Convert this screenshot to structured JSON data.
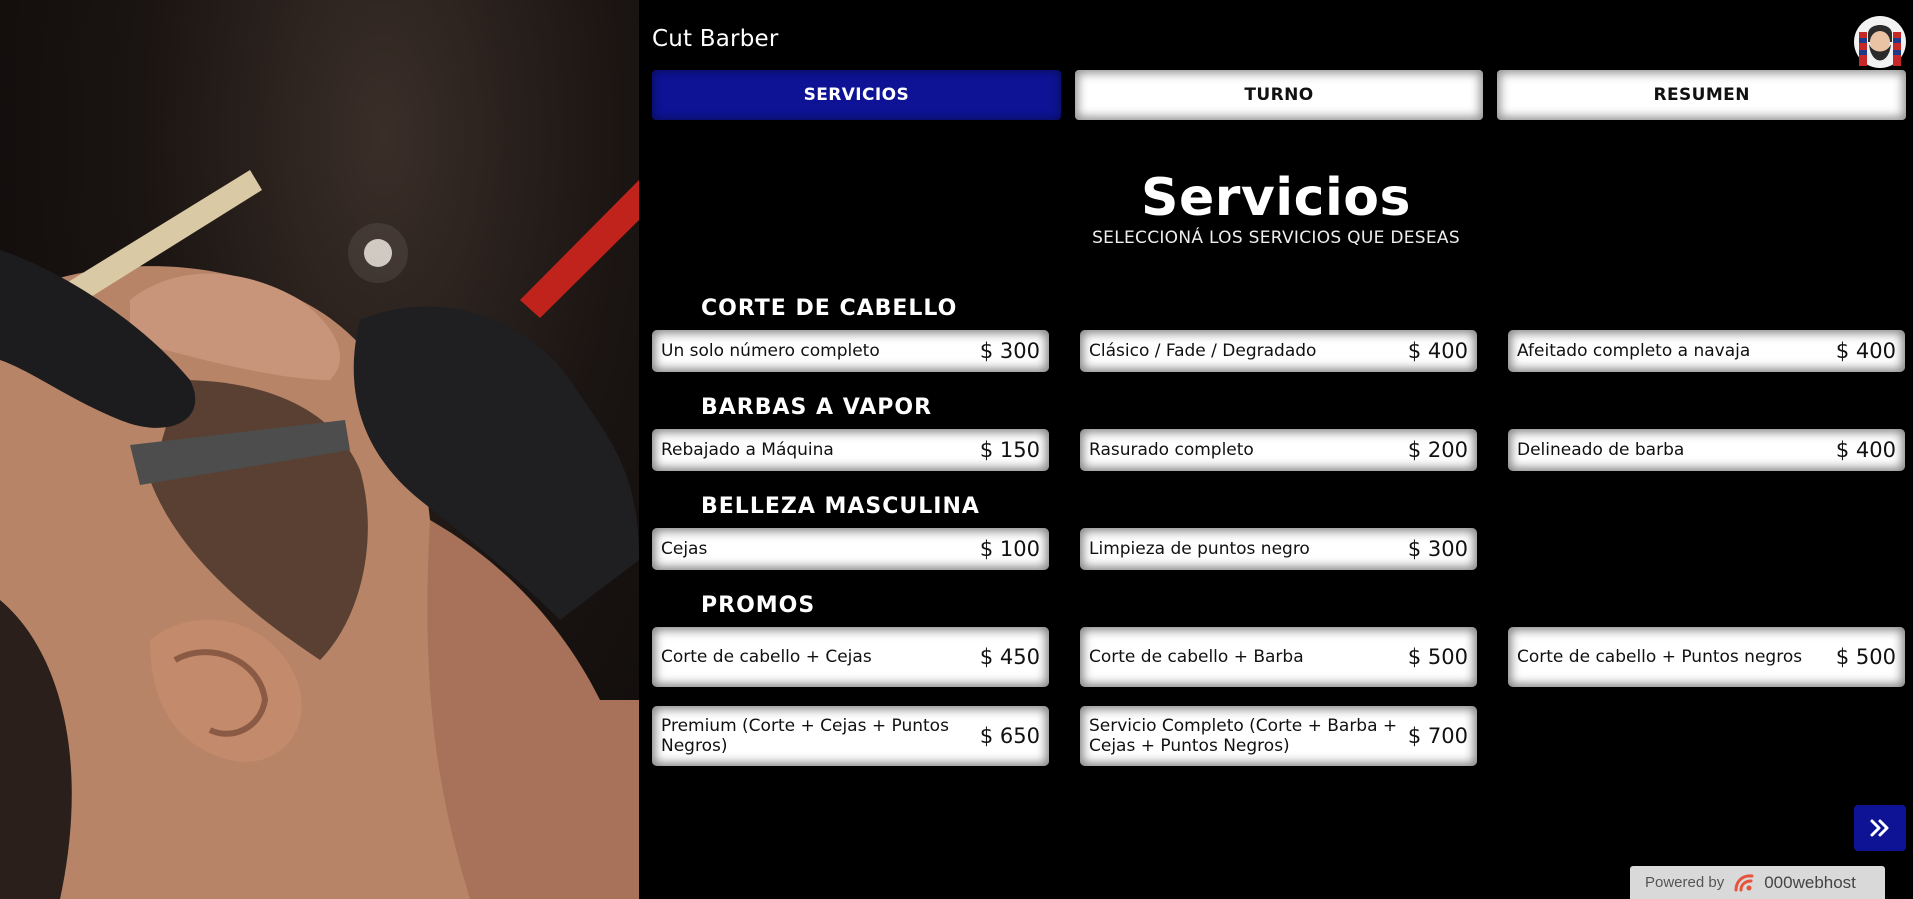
{
  "brand": {
    "name": "Cut Barber"
  },
  "tabs": [
    {
      "label": "SERVICIOS",
      "active": true
    },
    {
      "label": "TURNO",
      "active": false
    },
    {
      "label": "RESUMEN",
      "active": false
    }
  ],
  "section": {
    "title": "Servicios",
    "subtitle": "SELECCIONÁ LOS SERVICIOS QUE DESEAS"
  },
  "categories": [
    {
      "title": "CORTE DE CABELLO",
      "services": [
        {
          "name": "Un solo número completo",
          "price": "$ 300"
        },
        {
          "name": "Clásico / Fade / Degradado",
          "price": "$ 400"
        },
        {
          "name": "Afeitado completo a navaja",
          "price": "$ 400"
        }
      ]
    },
    {
      "title": "BARBAS A VAPOR",
      "services": [
        {
          "name": "Rebajado a Máquina",
          "price": "$ 150"
        },
        {
          "name": "Rasurado completo",
          "price": "$ 200"
        },
        {
          "name": "Delineado de barba",
          "price": "$ 400"
        }
      ]
    },
    {
      "title": "BELLEZA MASCULINA",
      "services": [
        {
          "name": "Cejas",
          "price": "$ 100"
        },
        {
          "name": "Limpieza de puntos negro",
          "price": "$ 300"
        }
      ]
    },
    {
      "title": "PROMOS",
      "services": [
        {
          "name": "Corte de cabello + Cejas",
          "price": "$ 450"
        },
        {
          "name": "Corte de cabello + Barba",
          "price": "$ 500"
        },
        {
          "name": "Corte de cabello + Puntos negros",
          "price": "$ 500"
        },
        {
          "name": "Premium (Corte + Cejas + Puntos Negros)",
          "price": "$ 650"
        },
        {
          "name": "Servicio Completo (Corte + Barba + Cejas + Puntos Negros)",
          "price": "$ 700"
        }
      ]
    }
  ],
  "next_button": {
    "icon": "double-chevron-right-icon"
  },
  "footer": {
    "powered_label": "Powered by",
    "host_name": "000webhost"
  },
  "colors": {
    "accent": "#0d1394",
    "background": "#000000",
    "card": "#ffffff"
  }
}
